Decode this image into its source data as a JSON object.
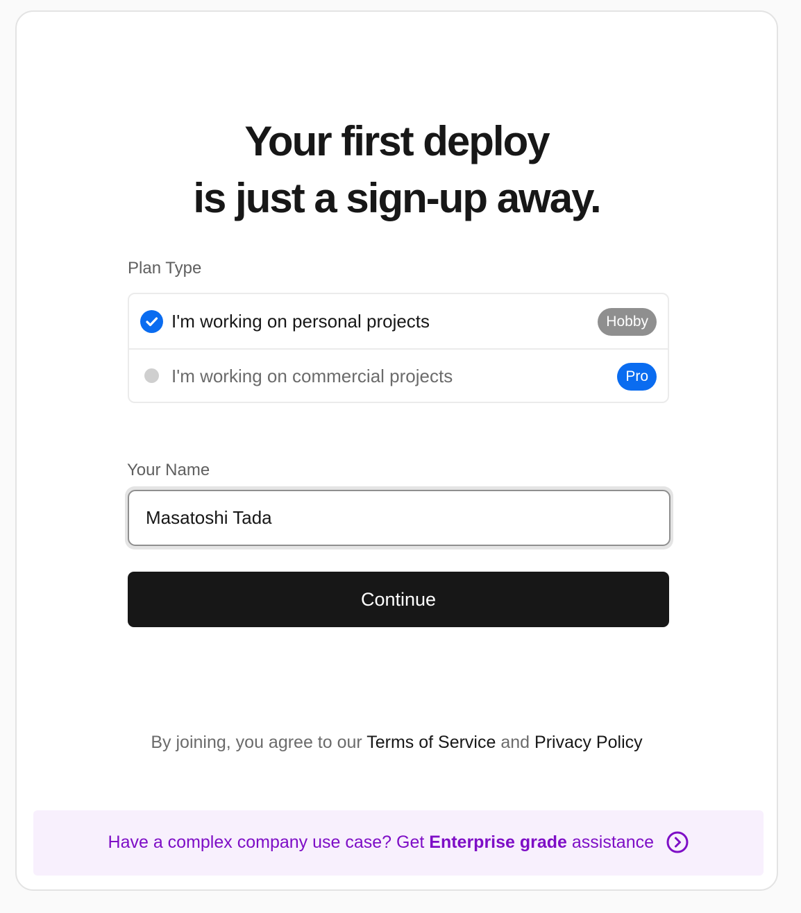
{
  "heading": {
    "line1": "Your first deploy",
    "line2": "is just a sign-up away."
  },
  "plan": {
    "label": "Plan Type",
    "options": [
      {
        "text": "I'm working on personal projects",
        "badge": "Hobby",
        "selected": true,
        "badge_color": "#8f8f8f"
      },
      {
        "text": "I'm working on commercial projects",
        "badge": "Pro",
        "selected": false,
        "badge_color": "#0a6cf0"
      }
    ]
  },
  "name": {
    "label": "Your Name",
    "value": "Masatoshi Tada"
  },
  "continue_label": "Continue",
  "terms": {
    "prefix": "By joining, you agree to our",
    "tos_link": "Terms of Service",
    "and": "and",
    "privacy_link": "Privacy Policy"
  },
  "enterprise": {
    "prefix": "Have a complex company use case? Get",
    "highlight": "Enterprise grade",
    "suffix": "assistance",
    "icon": "chevron-right-circle-icon"
  },
  "colors": {
    "accent_blue": "#0a6cf0",
    "enterprise_purple": "#7e0ec6",
    "enterprise_bg": "#f8f0fd",
    "button_bg": "#171717"
  }
}
